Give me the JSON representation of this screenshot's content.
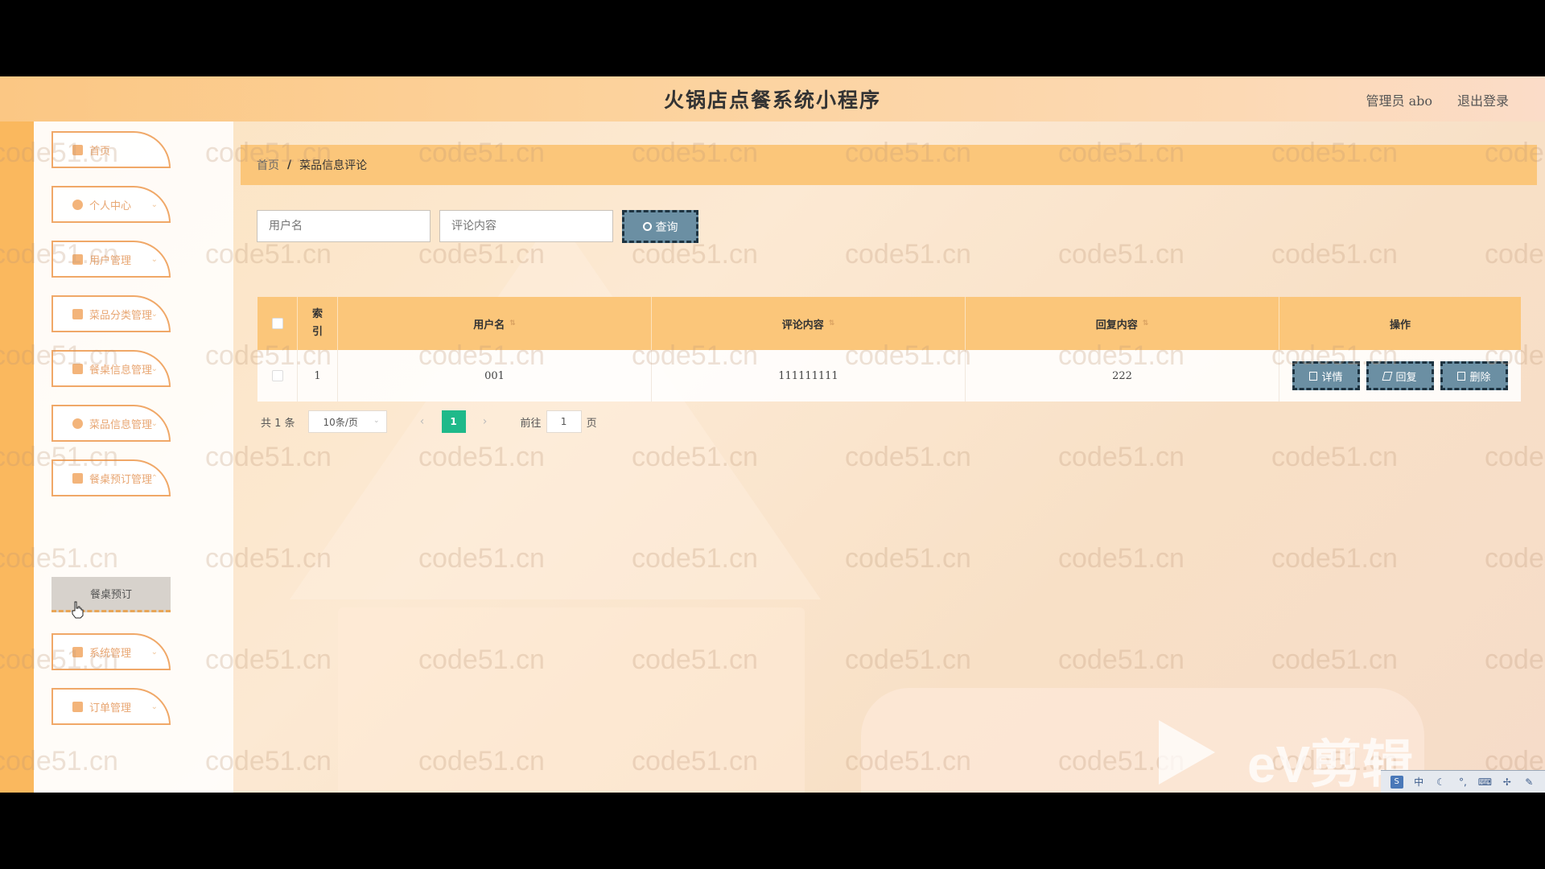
{
  "header": {
    "title": "火锅店点餐系统小程序",
    "admin_label": "管理员 abo",
    "logout_label": "退出登录"
  },
  "sidebar": {
    "items": [
      {
        "label": "首页",
        "icon": "home-icon"
      },
      {
        "label": "个人中心",
        "icon": "user-icon"
      },
      {
        "label": "用户管理",
        "icon": "flag-icon"
      },
      {
        "label": "菜品分类管理",
        "icon": "folder-icon"
      },
      {
        "label": "餐桌信息管理",
        "icon": "grid-icon"
      },
      {
        "label": "菜品信息管理",
        "icon": "leaf-icon"
      },
      {
        "label": "餐桌预订管理",
        "icon": "table-icon"
      },
      {
        "label": "系统管理",
        "icon": "apps-icon"
      },
      {
        "label": "订单管理",
        "icon": "apps-icon"
      }
    ],
    "active_sub_item": "餐桌预订"
  },
  "breadcrumb": {
    "home": "首页",
    "separator": "/",
    "current": "菜品信息评论"
  },
  "search": {
    "user_placeholder": "用户名",
    "comment_placeholder": "评论内容",
    "button_label": "查询"
  },
  "table": {
    "headers": {
      "index": [
        "索",
        "引"
      ],
      "username": "用户名",
      "comment": "评论内容",
      "reply": "回复内容",
      "ops": "操作"
    },
    "rows": [
      {
        "index": "1",
        "username": "001",
        "comment": "111111111",
        "reply": "222"
      }
    ],
    "row_actions": {
      "detail": "详情",
      "reply": "回复",
      "delete": "删除"
    }
  },
  "pagination": {
    "total": "共 1 条",
    "page_size": "10条/页",
    "current_page": "1",
    "goto_label": "前往",
    "goto_value": "1",
    "page_suffix": "页"
  },
  "watermark": {
    "text": "code51.cn"
  },
  "overlay": {
    "brand": "eV剪辑"
  },
  "tray": {
    "ime": "中"
  },
  "colors": {
    "header_bg": "#fbc784",
    "accent_orange": "#fab85e",
    "button_bg": "#6b8fa3",
    "pager_active": "#1fb98a"
  }
}
